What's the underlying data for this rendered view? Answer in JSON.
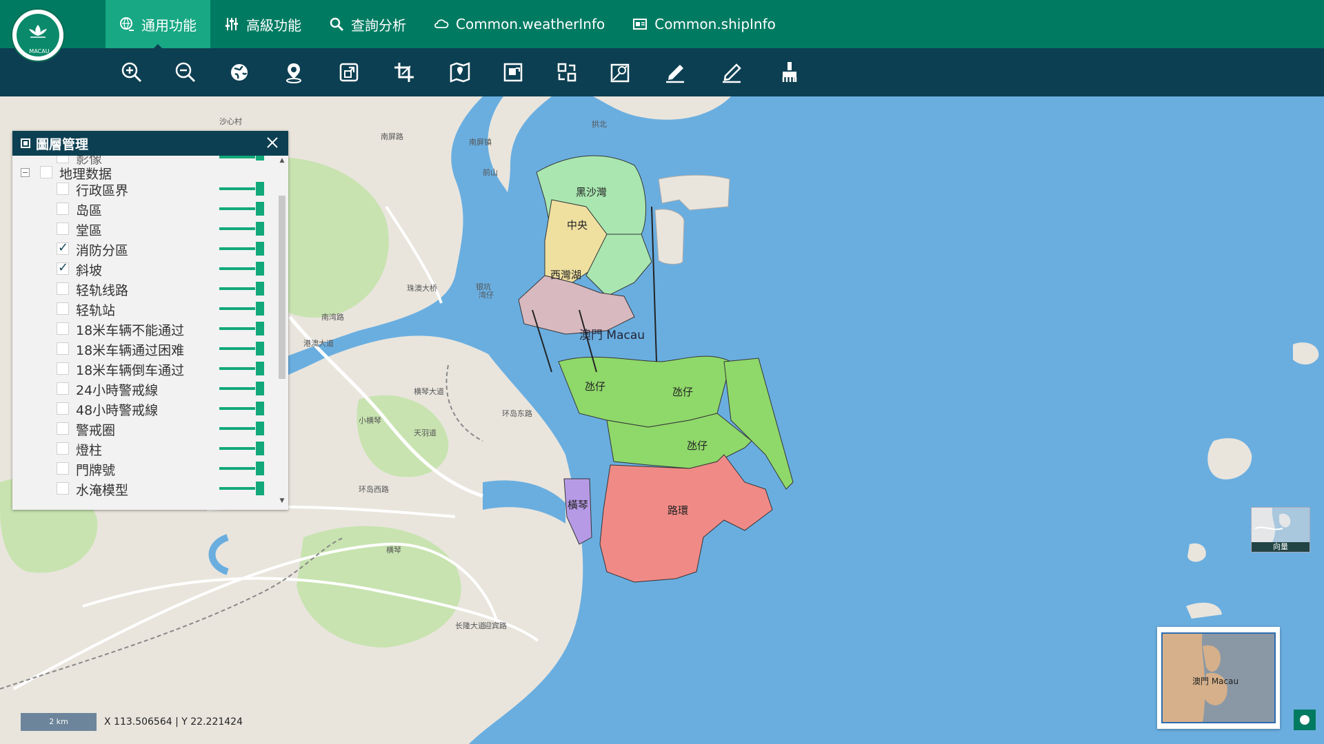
{
  "header": {
    "logo_text": "MACAU",
    "nav": [
      {
        "label": "通用功能",
        "icon": "globe-pin-icon",
        "active": true
      },
      {
        "label": "高級功能",
        "icon": "sliders-icon",
        "active": false
      },
      {
        "label": "查詢分析",
        "icon": "search-icon",
        "active": false
      },
      {
        "label": "Common.weatherInfo",
        "icon": "cloud-icon",
        "active": false
      },
      {
        "label": "Common.shipInfo",
        "icon": "ship-card-icon",
        "active": false
      }
    ]
  },
  "toolbar": {
    "tools": [
      {
        "name": "zoom-in-icon"
      },
      {
        "name": "zoom-out-icon"
      },
      {
        "name": "globe-icon"
      },
      {
        "name": "map-pin-icon"
      },
      {
        "name": "extent-icon"
      },
      {
        "name": "crop-icon"
      },
      {
        "name": "map-book-icon"
      },
      {
        "name": "frame-icon"
      },
      {
        "name": "swap-icon"
      },
      {
        "name": "measure-map-icon"
      },
      {
        "name": "ruler-pencil-icon"
      },
      {
        "name": "eraser-pencil-icon"
      },
      {
        "name": "clear-brush-icon"
      }
    ]
  },
  "layer_panel": {
    "title": "圖層管理",
    "partial_item": "影像",
    "group": {
      "label": "地理数据",
      "checked": false
    },
    "layers": [
      {
        "label": "行政區界",
        "checked": false
      },
      {
        "label": "岛區",
        "checked": false
      },
      {
        "label": "堂區",
        "checked": false
      },
      {
        "label": "消防分區",
        "checked": true
      },
      {
        "label": "斜坡",
        "checked": true
      },
      {
        "label": "轻轨线路",
        "checked": false
      },
      {
        "label": "轻轨站",
        "checked": false
      },
      {
        "label": "18米车辆不能通过",
        "checked": false
      },
      {
        "label": "18米车辆通过困难",
        "checked": false
      },
      {
        "label": "18米车辆倒车通过",
        "checked": false
      },
      {
        "label": "24小時警戒線",
        "checked": false
      },
      {
        "label": "48小時警戒線",
        "checked": false
      },
      {
        "label": "警戒圈",
        "checked": false
      },
      {
        "label": "燈柱",
        "checked": false
      },
      {
        "label": "門牌號",
        "checked": false
      },
      {
        "label": "水淹模型",
        "checked": false
      }
    ]
  },
  "map": {
    "city_label": "澳門 Macau",
    "zones": [
      {
        "label": "黑沙灣",
        "color": "#a9e6b0"
      },
      {
        "label": "中央",
        "color": "#efe0a0"
      },
      {
        "label": "西灣湖",
        "color": "#d8b9c0"
      },
      {
        "label": "氹仔",
        "color": "#8fd86a"
      },
      {
        "label": "氹仔",
        "color": "#8fd86a"
      },
      {
        "label": "氹仔",
        "color": "#8fd86a"
      },
      {
        "label": "橫琴",
        "color": "#b79ae6"
      },
      {
        "label": "路環",
        "color": "#f08a86"
      }
    ],
    "place_labels": [
      "南屏路",
      "沙心村",
      "南屏镇",
      "拱北",
      "前山",
      "湾仔",
      "南湾路",
      "珠澳大桥",
      "小横琴",
      "横琴",
      "长隆大道",
      "环岛西路",
      "环岛东路",
      "港澳大道",
      "横琴大道",
      "银坑",
      "天羽道",
      "迎宾路"
    ]
  },
  "scale": {
    "label": "2 km"
  },
  "coordinates": {
    "text": "X 113.506564 | Y 22.221424"
  },
  "minimap": {
    "label": "澳門 Macau"
  },
  "basemap": {
    "label": "向量"
  },
  "colors": {
    "header": "#007b62",
    "header_active": "#18a884",
    "toolbar": "#0d3f52",
    "sea": "#6aaee0",
    "land": "#e9e5dd",
    "slider": "#12a87a"
  }
}
